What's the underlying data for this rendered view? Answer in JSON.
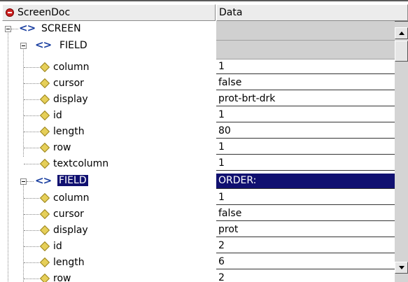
{
  "header": {
    "name_col": "ScreenDoc",
    "data_col": "Data"
  },
  "tree": [
    {
      "label": "SCREEN",
      "kind": "tag",
      "data": ""
    },
    {
      "label": "FIELD",
      "kind": "tag",
      "data": ""
    },
    {
      "label": "column",
      "kind": "attr",
      "data": "1"
    },
    {
      "label": "cursor",
      "kind": "attr",
      "data": "false"
    },
    {
      "label": "display",
      "kind": "attr",
      "data": "prot-brt-drk"
    },
    {
      "label": "id",
      "kind": "attr",
      "data": "1"
    },
    {
      "label": "length",
      "kind": "attr",
      "data": "80"
    },
    {
      "label": "row",
      "kind": "attr",
      "data": "1"
    },
    {
      "label": "textcolumn",
      "kind": "attr",
      "data": "1"
    },
    {
      "label": "FIELD",
      "kind": "tag",
      "data": "ORDER:",
      "selected": true
    },
    {
      "label": "column",
      "kind": "attr",
      "data": "1"
    },
    {
      "label": "cursor",
      "kind": "attr",
      "data": "false"
    },
    {
      "label": "display",
      "kind": "attr",
      "data": "prot"
    },
    {
      "label": "id",
      "kind": "attr",
      "data": "2"
    },
    {
      "label": "length",
      "kind": "attr",
      "data": "6"
    },
    {
      "label": "row",
      "kind": "attr",
      "data": "2"
    }
  ]
}
